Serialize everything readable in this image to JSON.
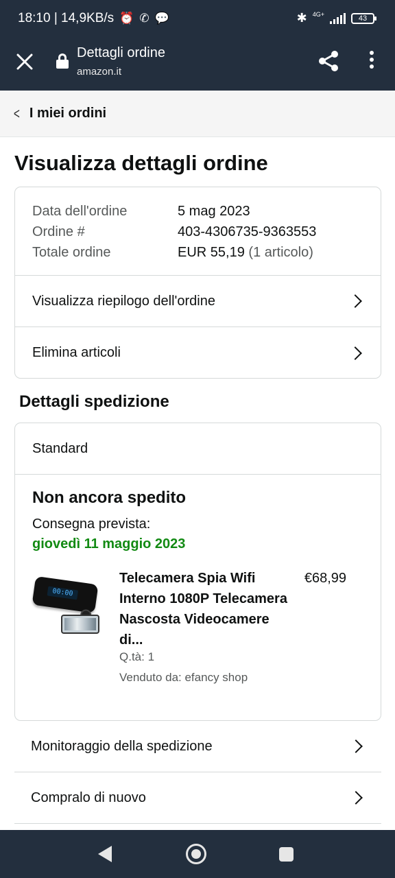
{
  "status_bar": {
    "time_speed": "18:10 | 14,9KB/s",
    "network": "4G+",
    "battery": "43"
  },
  "browser": {
    "title": "Dettagli ordine",
    "url": "amazon.it",
    "icons": [
      "close-icon",
      "lock-icon",
      "share-icon",
      "more-vert-icon"
    ]
  },
  "breadcrumb": {
    "label": "I miei ordini"
  },
  "page": {
    "title": "Visualizza dettagli ordine"
  },
  "order": {
    "date_label": "Data dell'ordine",
    "date_value": "5 mag 2023",
    "number_label": "Ordine #",
    "number_value": "403-4306735-9363553",
    "total_label": "Totale ordine",
    "total_value": "EUR 55,19",
    "total_items": "(1 articolo)",
    "links": {
      "summary": "Visualizza riepilogo dell'ordine",
      "delete": "Elimina articoli"
    }
  },
  "shipping": {
    "section_title": "Dettagli spedizione",
    "method": "Standard",
    "status_title": "Non ancora spedito",
    "delivery_label": "Consegna prevista:",
    "delivery_date": "giovedì 11 maggio 2023",
    "delivery_date_color": "#128a13",
    "product": {
      "title": "Telecamera Spia Wifi Interno 1080P Telecamera Nascosta Videocamere di...",
      "price": "€68,99",
      "qty": "Q.tà: 1",
      "seller": "Venduto da: efancy shop",
      "clock_display": "00:00"
    }
  },
  "actions": {
    "track": "Monitoraggio della spedizione",
    "buy_again": "Compralo di nuovo"
  },
  "colors": {
    "header_bg": "#232f3e",
    "text": "#0f1111",
    "muted": "#565959"
  }
}
